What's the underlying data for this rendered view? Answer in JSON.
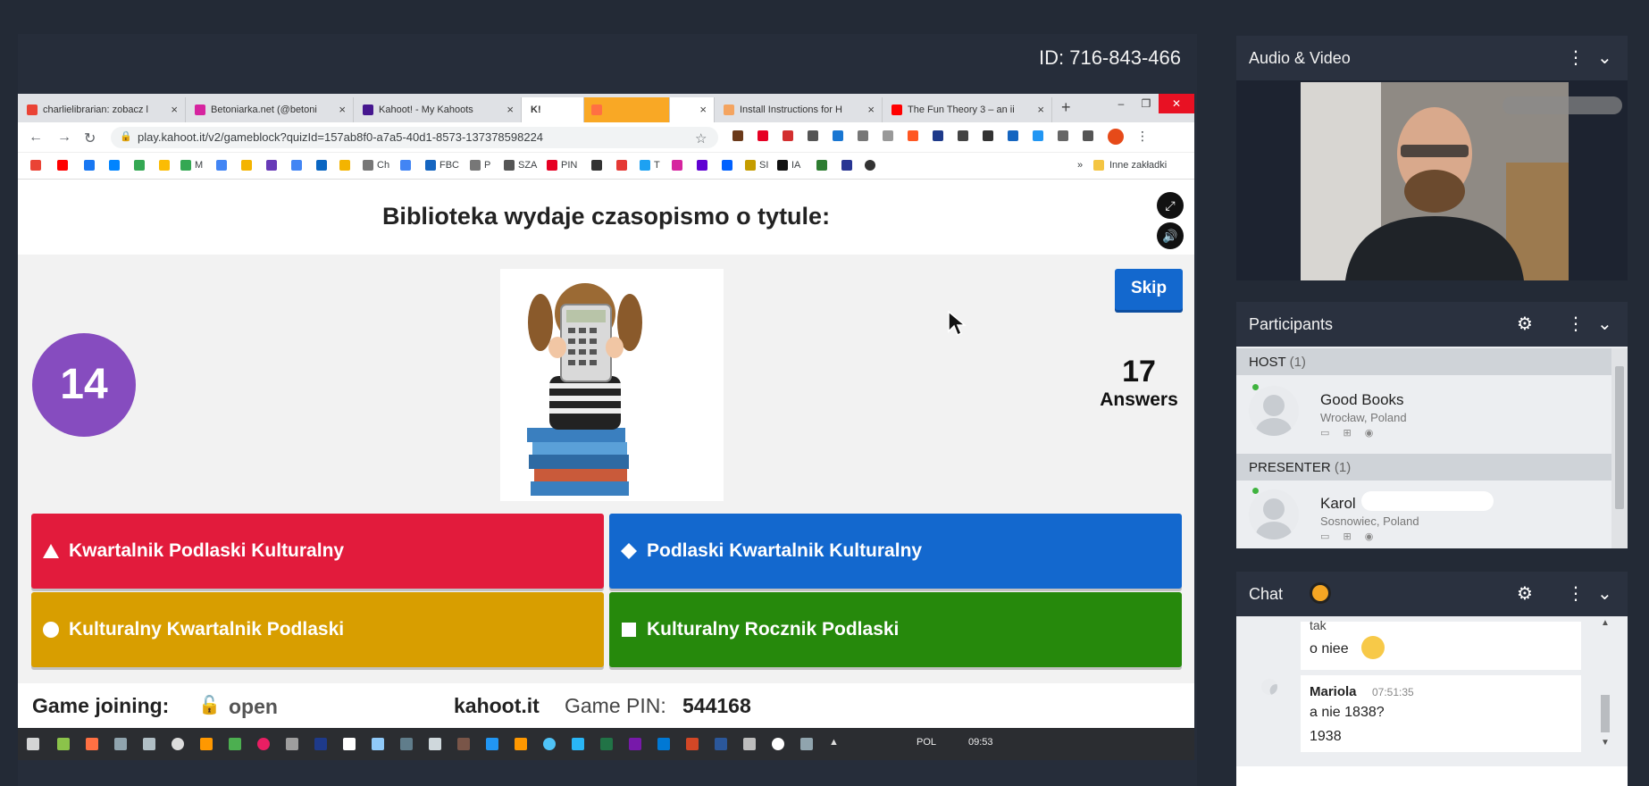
{
  "session": {
    "id_label": "ID: 716-843-466"
  },
  "browser": {
    "tabs": [
      {
        "label": "charlielibrarian: zobacz l",
        "icon_color": "#ea4335"
      },
      {
        "label": "Betoniarka.net (@betoni",
        "icon_color": "#d6249f"
      },
      {
        "label": "Kahoot! - My Kahoots",
        "icon_color": "#46178f"
      },
      {
        "label": "K!",
        "icon_color": "#46178f"
      },
      {
        "label": "Install Instructions for H",
        "icon_color": "#f4a460"
      },
      {
        "label": "The Fun Theory 3 – an ii",
        "icon_color": "#ff0000"
      }
    ],
    "url": "play.kahoot.it/v2/gameblock?quizId=157ab8f0-a7a5-40d1-8573-137378598224",
    "bookmarks": [
      "M",
      "Ch",
      "FBC",
      "P",
      "SZA",
      "PIN",
      "T",
      "SI",
      "IA",
      "Inne zakładki"
    ]
  },
  "kahoot": {
    "question": "Biblioteka wydaje czasopismo o tytule:",
    "timer": "14",
    "skip_label": "Skip",
    "answers_count": "17",
    "answers_label": "Answers",
    "answers": [
      {
        "text": "Kwartalnik Podlaski Kulturalny",
        "shape": "triangle-icon",
        "color": "#e21b3c"
      },
      {
        "text": "Podlaski Kwartalnik Kulturalny",
        "shape": "diamond-icon",
        "color": "#1368ce"
      },
      {
        "text": "Kulturalny Kwartalnik Podlaski",
        "shape": "circle-icon",
        "color": "#d89e00"
      },
      {
        "text": "Kulturalny Rocznik Podlaski",
        "shape": "square-icon",
        "color": "#26890c"
      }
    ],
    "footer": {
      "joining_label": "Game joining:",
      "joining_state": "open",
      "site": "kahoot.it",
      "pin_label": "Game PIN:",
      "pin": "544168"
    }
  },
  "taskbar": {
    "lang": "POL",
    "time": "09:53"
  },
  "sidebar": {
    "audio_video_title": "Audio & Video",
    "participants": {
      "title": "Participants",
      "host_group": "HOST",
      "host_count": "(1)",
      "host": {
        "name": "Good Books",
        "location": "Wrocław, Poland"
      },
      "presenter_group": "PRESENTER",
      "presenter_count": "(1)",
      "presenter": {
        "name": "Karol",
        "location": "Sosnowiec, Poland"
      }
    },
    "chat": {
      "title": "Chat",
      "messages": [
        {
          "text_top": "tak",
          "text": "o niee"
        },
        {
          "author": "Mariola",
          "time": "07:51:35",
          "lines": [
            "a nie 1838?",
            "1938"
          ]
        }
      ]
    }
  },
  "colors": {
    "kahoot_purple": "#864cbf",
    "skip_blue": "#1368ce",
    "panel_header": "#2a313f"
  }
}
